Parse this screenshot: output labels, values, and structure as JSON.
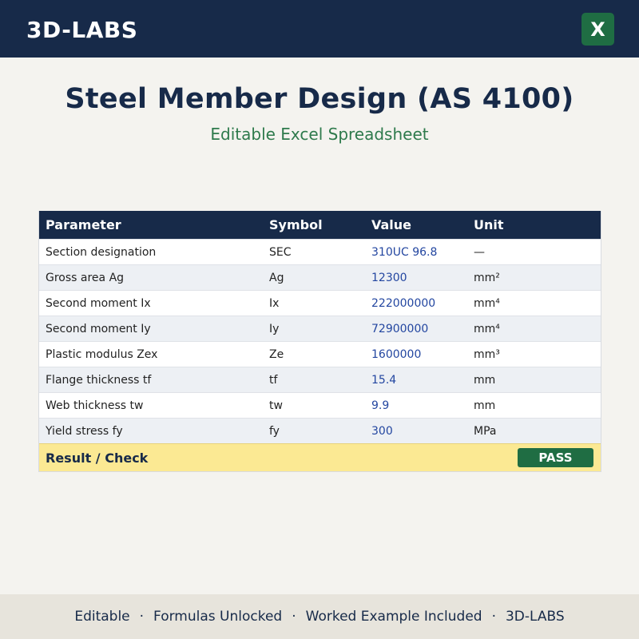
{
  "header": {
    "brand": "3D-LABS",
    "excel_icon_glyph": "X",
    "excel_icon_name": "excel-icon",
    "bg_color": "#172a49"
  },
  "hero": {
    "title": "Steel Member Design (AS 4100)",
    "subtitle": "Editable Excel Spreadsheet"
  },
  "table": {
    "columns": [
      "Parameter",
      "Symbol",
      "Value",
      "Unit"
    ],
    "rows": [
      {
        "parameter": "Section designation",
        "symbol": "SEC",
        "value": "310UC 96.8",
        "unit": "—"
      },
      {
        "parameter": "Gross area Ag",
        "symbol": "Ag",
        "value": "12300",
        "unit": "mm²"
      },
      {
        "parameter": "Second moment Ix",
        "symbol": "Ix",
        "value": "222000000",
        "unit": "mm⁴"
      },
      {
        "parameter": "Second moment Iy",
        "symbol": "Iy",
        "value": "72900000",
        "unit": "mm⁴"
      },
      {
        "parameter": "Plastic modulus Zex",
        "symbol": "Ze",
        "value": "1600000",
        "unit": "mm³"
      },
      {
        "parameter": "Flange thickness tf",
        "symbol": "tf",
        "value": "15.4",
        "unit": "mm"
      },
      {
        "parameter": "Web thickness tw",
        "symbol": "tw",
        "value": "9.9",
        "unit": "mm"
      },
      {
        "parameter": "Yield stress fy",
        "symbol": "fy",
        "value": "300",
        "unit": "MPa"
      }
    ],
    "result_label": "Result / Check",
    "result_status": "PASS"
  },
  "footer": {
    "items": [
      "Editable",
      "Formulas Unlocked",
      "Worked Example Included",
      "3D-LABS"
    ],
    "separator": "·"
  }
}
